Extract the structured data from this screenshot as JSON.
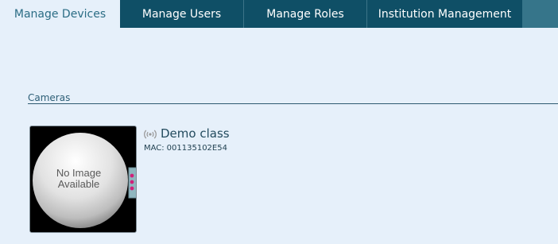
{
  "tabs": [
    {
      "label": "Manage Devices",
      "active": true
    },
    {
      "label": "Manage Users",
      "active": false
    },
    {
      "label": "Manage Roles",
      "active": false
    },
    {
      "label": "Institution Management",
      "active": false
    }
  ],
  "section": {
    "label": "Cameras"
  },
  "devices": [
    {
      "name": "Demo class",
      "mac_label": "MAC:",
      "mac_value": "001135102E54",
      "thumbnail_text": "No Image\nAvailable",
      "status_icon": "wireless-signal-icon"
    }
  ],
  "colors": {
    "tab_bg": "#0f4f66",
    "tab_bar_bg": "#36758a",
    "page_bg": "#e6f0fa",
    "active_tab_text": "#2b6d85",
    "camera_led": "#d0207a"
  }
}
